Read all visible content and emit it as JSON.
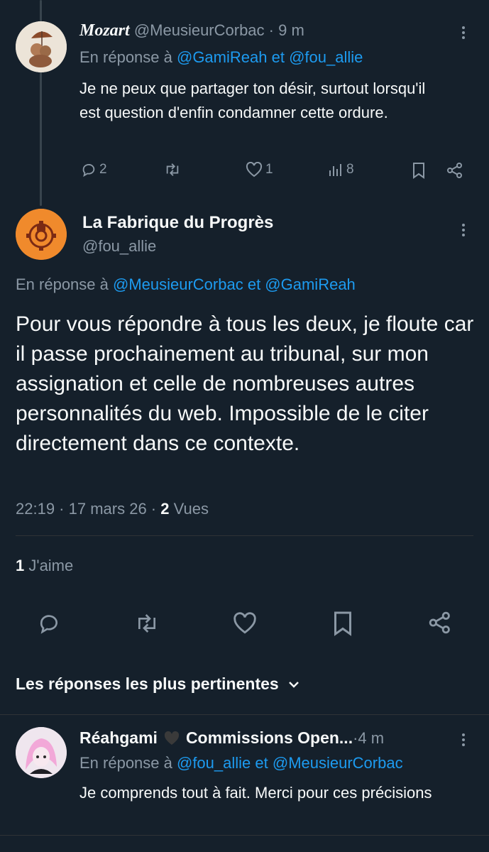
{
  "reply1": {
    "name": "Mozart",
    "handle": "@MeusieurCorbac",
    "sep": " · ",
    "time": "9 m",
    "reply_prefix": "En réponse à ",
    "reply_to_1": "@GamiReah",
    "reply_and": " et ",
    "reply_to_2": "@fou_allie",
    "text": "Je ne peux que partager ton désir, surtout lorsqu'il est question d'enfin condamner cette ordure.",
    "replies": "2",
    "retweets": "",
    "likes": "1",
    "views": "8"
  },
  "main": {
    "name": "La Fabrique du Progrès",
    "handle": "@fou_allie",
    "reply_prefix": "En réponse à ",
    "reply_to_1": "@MeusieurCorbac",
    "reply_and": " et ",
    "reply_to_2": "@GamiReah",
    "text": "Pour vous répondre à tous les deux, je floute car il passe prochainement au tribunal, sur mon assignation et celle de nombreuses autres personnalités du web. Impossible de le citer directement dans ce contexte.",
    "time": "22:19",
    "date": "17 mars 26",
    "views_count": "2",
    "views_label": " Vues",
    "likes_count": "1",
    "likes_label": " J'aime"
  },
  "sort": {
    "label": "Les réponses les plus pertinentes"
  },
  "reply2": {
    "name": "Réahgami",
    "name_rest": "Commissions Open...",
    "sep": " · ",
    "time": "4 m",
    "reply_prefix": "En réponse à ",
    "reply_to_1": "@fou_allie",
    "reply_and": " et ",
    "reply_to_2": "@MeusieurCorbac",
    "text": "Je comprends tout à fait. Merci pour ces précisions"
  },
  "colors": {
    "background": "#15202b",
    "text": "#f7f9f9",
    "muted": "#8b98a5",
    "link": "#1d9bf0",
    "brand_orange": "#f08a2c"
  }
}
